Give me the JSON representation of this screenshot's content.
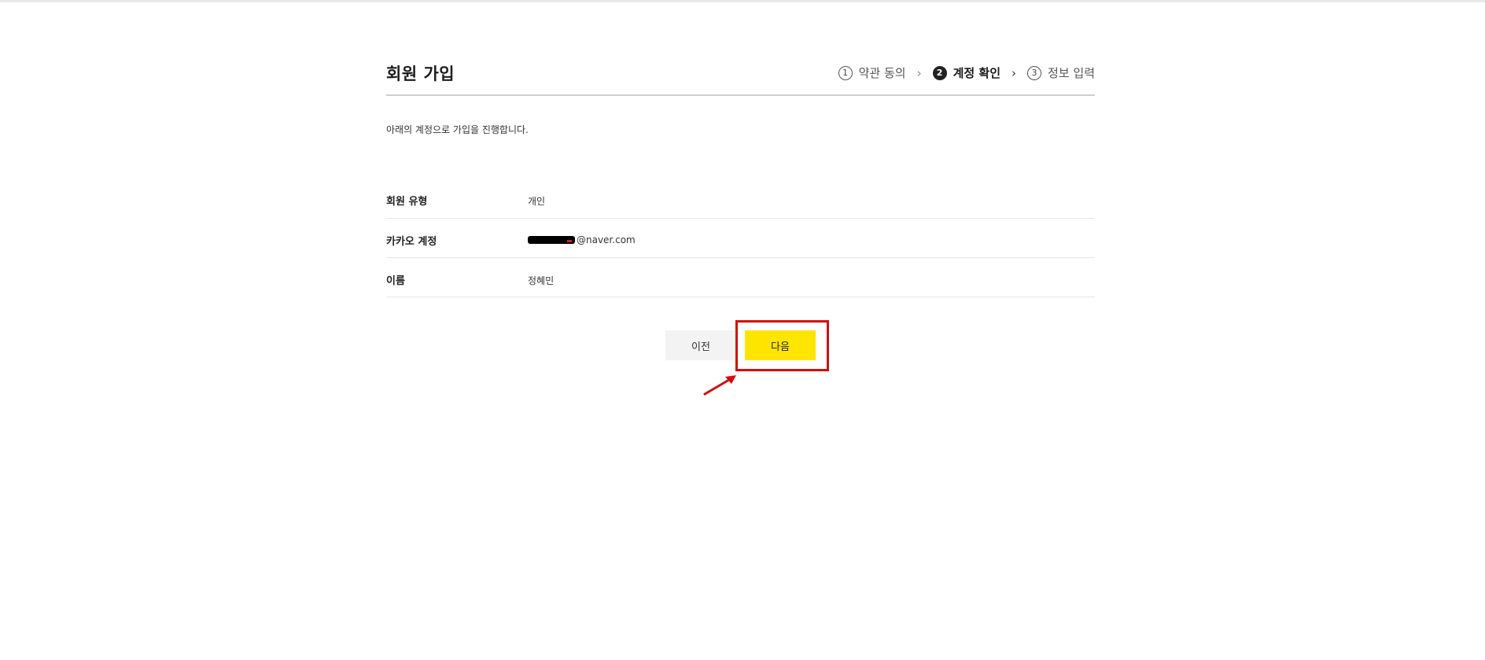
{
  "header": {
    "title": "회원 가입",
    "steps": [
      {
        "num": "1",
        "label": "약관 동의",
        "state": "done"
      },
      {
        "num": "2",
        "label": "계정 확인",
        "state": "active"
      },
      {
        "num": "3",
        "label": "정보 입력",
        "state": "pending"
      }
    ]
  },
  "description": "아래의 계정으로 가입을 진행합니다.",
  "info": {
    "member_type": {
      "label": "회원 유형",
      "value": "개인"
    },
    "kakao_account": {
      "label": "카카오 계정",
      "value": "@naver.com"
    },
    "name": {
      "label": "이름",
      "value": "정혜민"
    }
  },
  "buttons": {
    "prev": "이전",
    "next": "다음"
  },
  "colors": {
    "next_button": "#fee500",
    "prev_button": "#f3f3f3",
    "annotation": "#d60d0d"
  },
  "icons": {
    "step_separator": "chevron-right-icon",
    "annotation": "arrow-icon"
  }
}
